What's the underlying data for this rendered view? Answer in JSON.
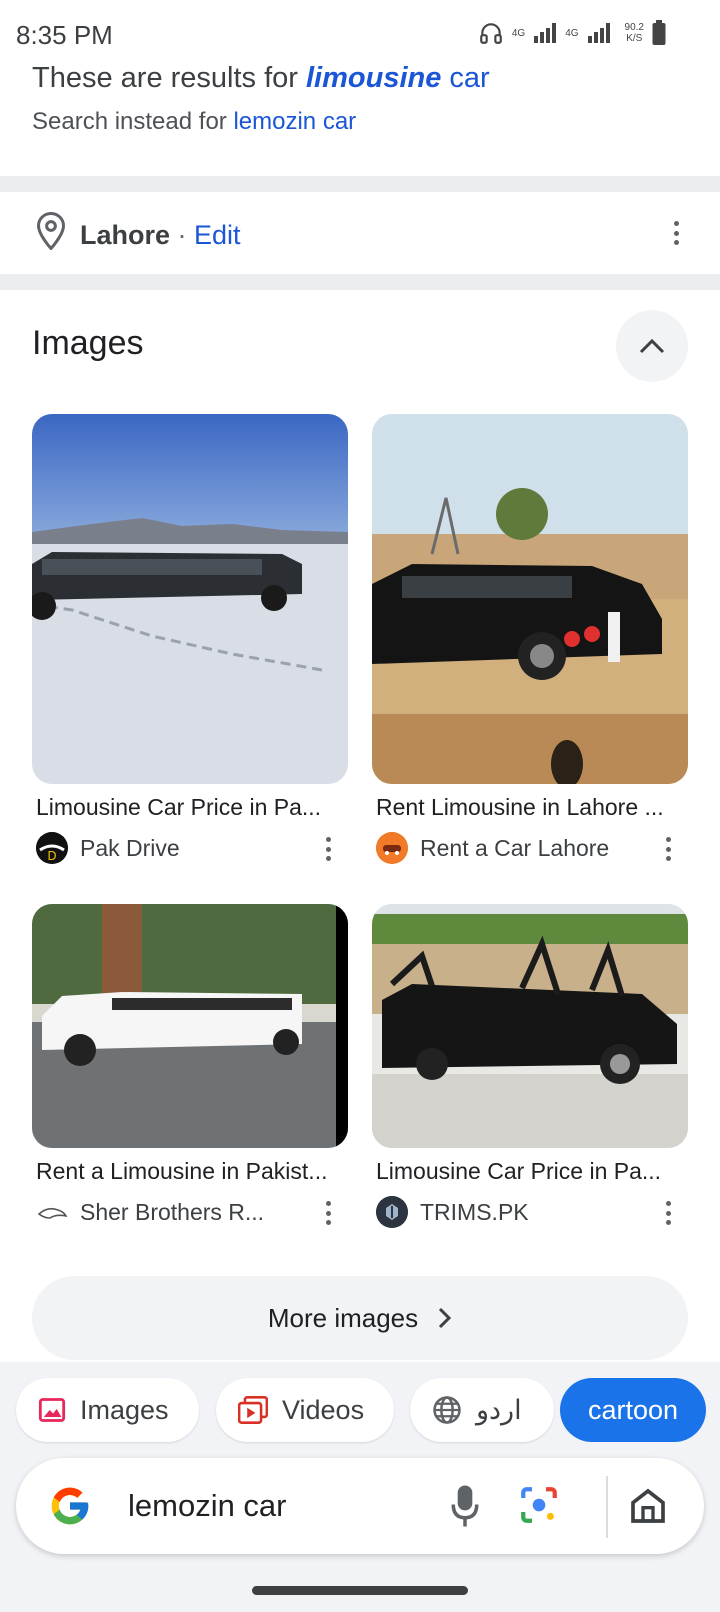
{
  "status_bar": {
    "time": "8:35 PM",
    "net_type_1": "4G",
    "net_type_2": "4G",
    "speed_value": "90.2",
    "speed_unit": "K/S"
  },
  "results_note": {
    "prefix": "These are results for ",
    "query_bold": "limousine",
    "query_rest": " car",
    "search_instead_prefix": "Search instead for ",
    "search_instead_link": "lemozin car"
  },
  "location": {
    "city": "Lahore",
    "separator": " · ",
    "edit_label": "Edit"
  },
  "images_section": {
    "title": "Images",
    "items": [
      {
        "title": "Limousine Car Price in Pa...",
        "source": "Pak Drive"
      },
      {
        "title": "Rent Limousine in Lahore ...",
        "source": "Rent a Car Lahore"
      },
      {
        "title": "Rent a Limousine in Pakist...",
        "source": "Sher Brothers R..."
      },
      {
        "title": "Limousine Car Price in Pa...",
        "source": "TRIMS.PK"
      }
    ],
    "more_label": "More images"
  },
  "filter_chips": [
    {
      "label": "Images",
      "icon": "image-icon"
    },
    {
      "label": "Videos",
      "icon": "video-icon"
    },
    {
      "label": "اردو",
      "icon": "globe-icon"
    },
    {
      "label": "cartoon",
      "active": true
    }
  ],
  "search_bar": {
    "query": "lemozin car",
    "icons": [
      "google-logo-icon",
      "mic-icon",
      "lens-icon",
      "home-icon"
    ]
  },
  "colors": {
    "link_blue": "#1a56d6",
    "chip_active": "#1a73e8",
    "panel_bg": "#f1f3f6"
  }
}
